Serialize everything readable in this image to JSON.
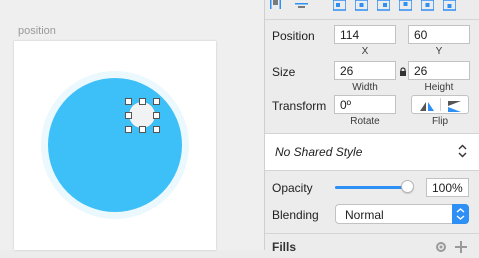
{
  "canvas": {
    "artboard_name": "position"
  },
  "inspector": {
    "position": {
      "label": "Position",
      "x": "114",
      "y": "60",
      "x_caption": "X",
      "y_caption": "Y"
    },
    "size": {
      "label": "Size",
      "width": "26",
      "height": "26",
      "width_caption": "Width",
      "height_caption": "Height"
    },
    "transform": {
      "label": "Transform",
      "rotate": "0º",
      "rotate_caption": "Rotate",
      "flip_caption": "Flip"
    },
    "shared_style": {
      "value": "No Shared Style"
    },
    "opacity": {
      "label": "Opacity",
      "value": "100%",
      "level": 1.0
    },
    "blending": {
      "label": "Blending",
      "value": "Normal"
    },
    "fills": {
      "label": "Fills"
    }
  },
  "colors": {
    "circle": "#3cc0f7",
    "accent": "#2e8ff5"
  }
}
